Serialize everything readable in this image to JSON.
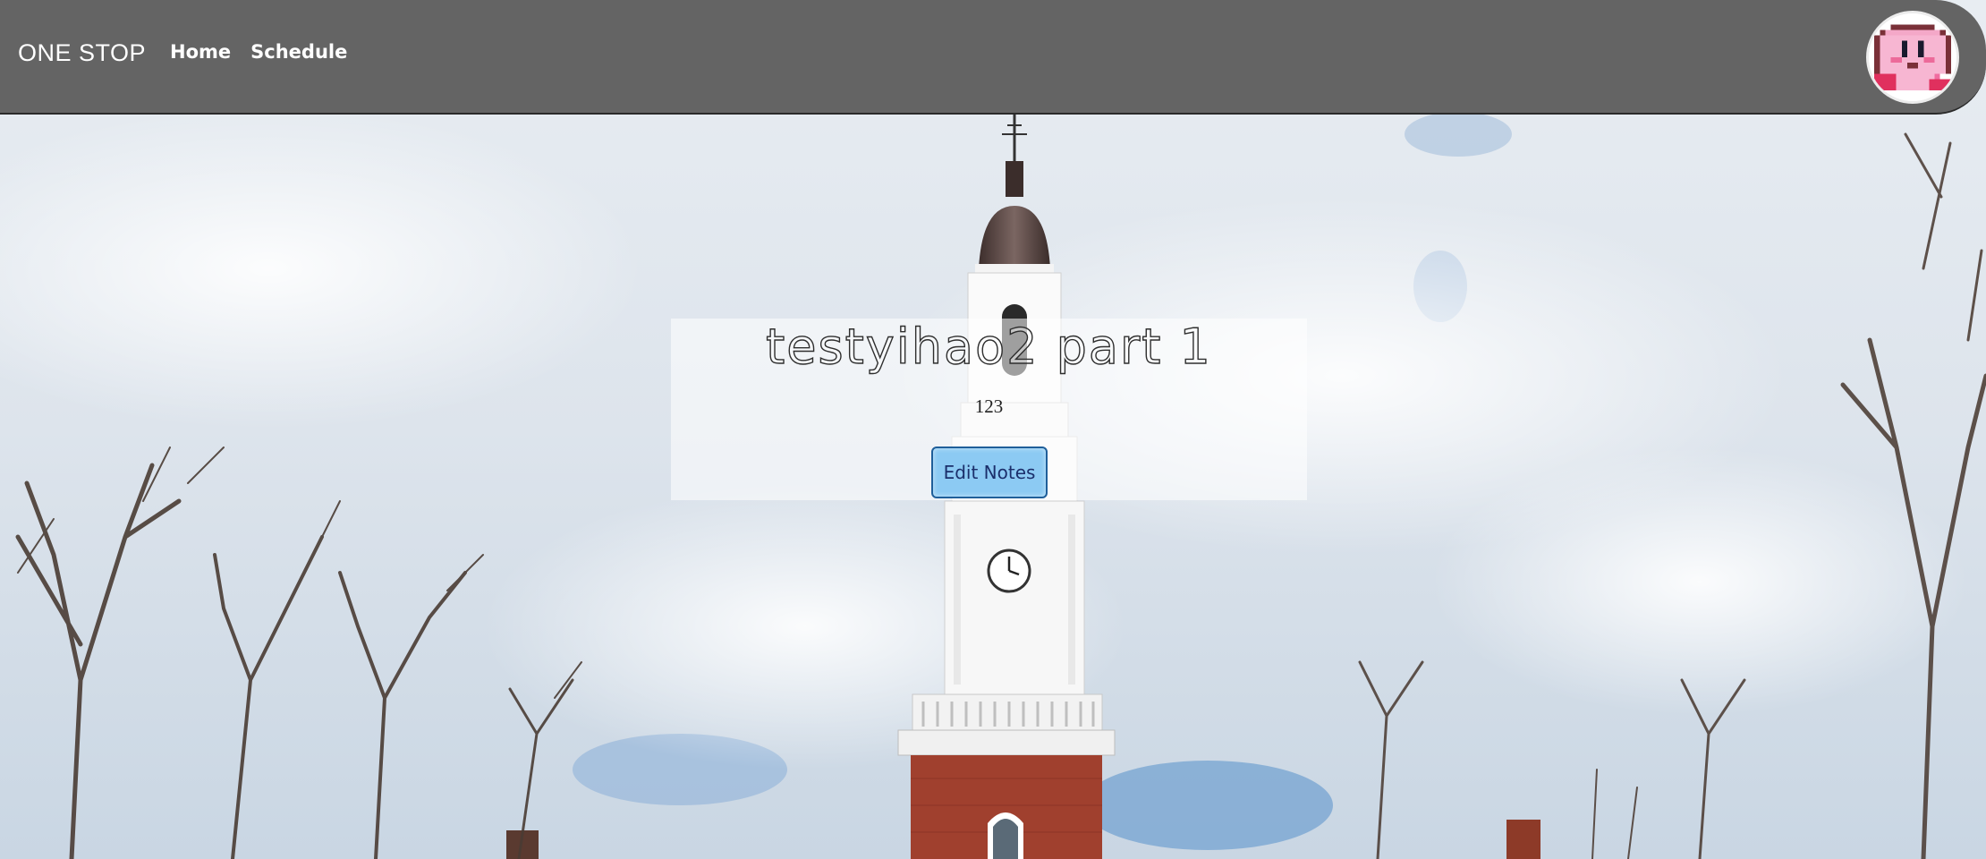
{
  "nav": {
    "brand": "ONE STOP",
    "links": [
      {
        "label": "Home"
      },
      {
        "label": "Schedule"
      }
    ]
  },
  "note": {
    "title": "testyihao2 part 1",
    "body": "123",
    "edit_label": "Edit Notes"
  },
  "colors": {
    "navbar": "#646464",
    "button": "#8ccaf3",
    "button_border": "#1f5f9a"
  },
  "icons": {
    "avatar": "kirby-avatar-icon"
  }
}
